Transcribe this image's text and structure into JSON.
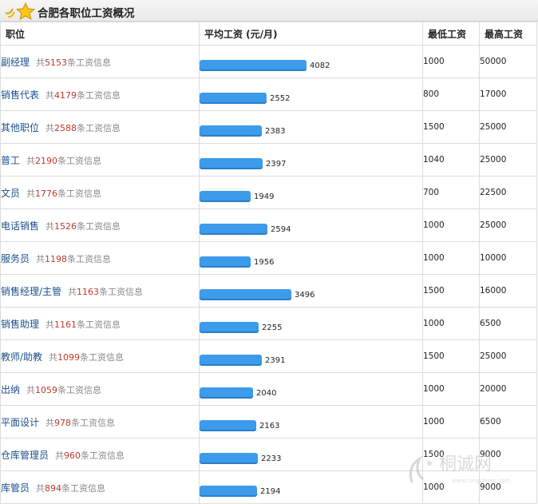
{
  "header": {
    "title": "合肥各职位工资概况"
  },
  "table": {
    "columns": [
      "职位",
      "平均工资 (元/月)",
      "最低工资",
      "最高工资"
    ],
    "count_prefix": "共",
    "count_suffix": "条工资信息",
    "bar_scale_max": 4082,
    "rows": [
      {
        "job": "副经理",
        "count": "5153",
        "avg": "4082",
        "min": "1000",
        "max": "50000"
      },
      {
        "job": "销售代表",
        "count": "4179",
        "avg": "2552",
        "min": "800",
        "max": "17000"
      },
      {
        "job": "其他职位",
        "count": "2588",
        "avg": "2383",
        "min": "1500",
        "max": "25000"
      },
      {
        "job": "普工",
        "count": "2190",
        "avg": "2397",
        "min": "1040",
        "max": "25000"
      },
      {
        "job": "文员",
        "count": "1776",
        "avg": "1949",
        "min": "700",
        "max": "22500"
      },
      {
        "job": "电话销售",
        "count": "1526",
        "avg": "2594",
        "min": "1000",
        "max": "25000"
      },
      {
        "job": "服务员",
        "count": "1198",
        "avg": "1956",
        "min": "1000",
        "max": "10000"
      },
      {
        "job": "销售经理/主管",
        "count": "1163",
        "avg": "3496",
        "min": "1500",
        "max": "16000"
      },
      {
        "job": "销售助理",
        "count": "1161",
        "avg": "2255",
        "min": "1000",
        "max": "6500"
      },
      {
        "job": "教师/助教",
        "count": "1099",
        "avg": "2391",
        "min": "1500",
        "max": "25000"
      },
      {
        "job": "出纳",
        "count": "1059",
        "avg": "2040",
        "min": "1000",
        "max": "20000"
      },
      {
        "job": "平面设计",
        "count": "978",
        "avg": "2163",
        "min": "1000",
        "max": "6500"
      },
      {
        "job": "仓库管理员",
        "count": "960",
        "avg": "2233",
        "min": "1500",
        "max": "9000"
      },
      {
        "job": "库管员",
        "count": "894",
        "avg": "2194",
        "min": "1000",
        "max": "9000"
      }
    ]
  },
  "watermark": {
    "text": "桐诚网",
    "subtext": "www.tongcheng.com"
  },
  "colors": {
    "bar": "#3c9bea",
    "link": "#1b4f8a",
    "count_number": "#c0392b"
  },
  "icons": {
    "title": "star-icon"
  }
}
